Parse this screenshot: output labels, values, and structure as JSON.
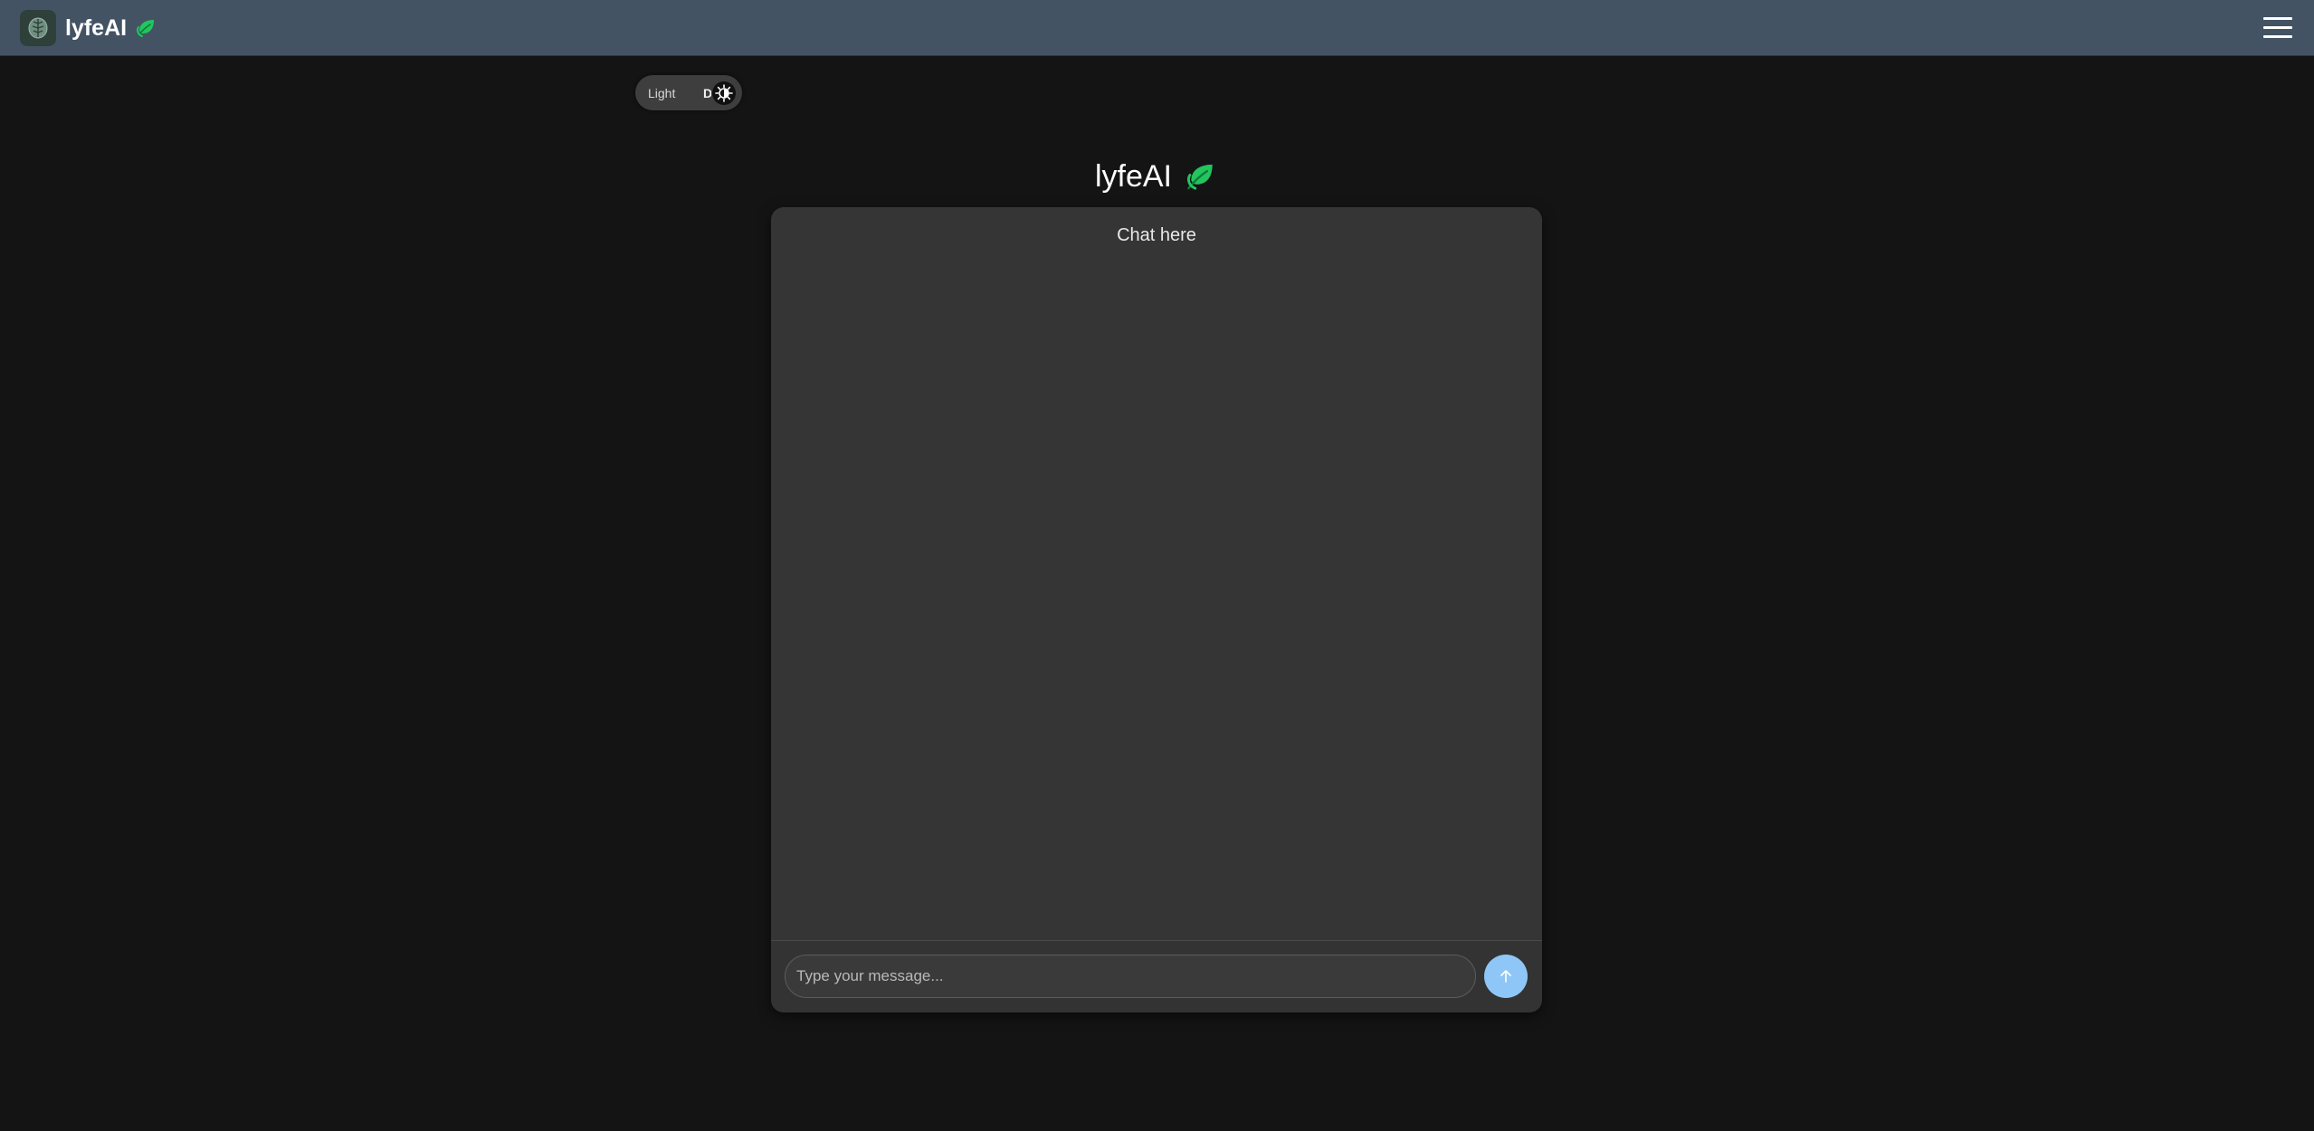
{
  "navbar": {
    "brand_name": "lyfeAI",
    "logo_icon": "brain-leaf-logo-icon",
    "leaf_icon": "leaf-icon",
    "menu_icon": "hamburger-menu-icon"
  },
  "theme_toggle": {
    "light_label": "Light",
    "dark_label": "Dark",
    "knob_icon": "contrast-icon"
  },
  "chat": {
    "title": "lyfeAI",
    "title_icon": "leaf-icon",
    "header": "Chat here",
    "input_placeholder": "Type your message...",
    "input_value": "",
    "send_icon": "arrow-up-icon"
  },
  "colors": {
    "background": "#141414",
    "navbar": "#435364",
    "card": "#353535",
    "leaf_green": "#22c55e",
    "send_button": "#8ec7f7"
  }
}
